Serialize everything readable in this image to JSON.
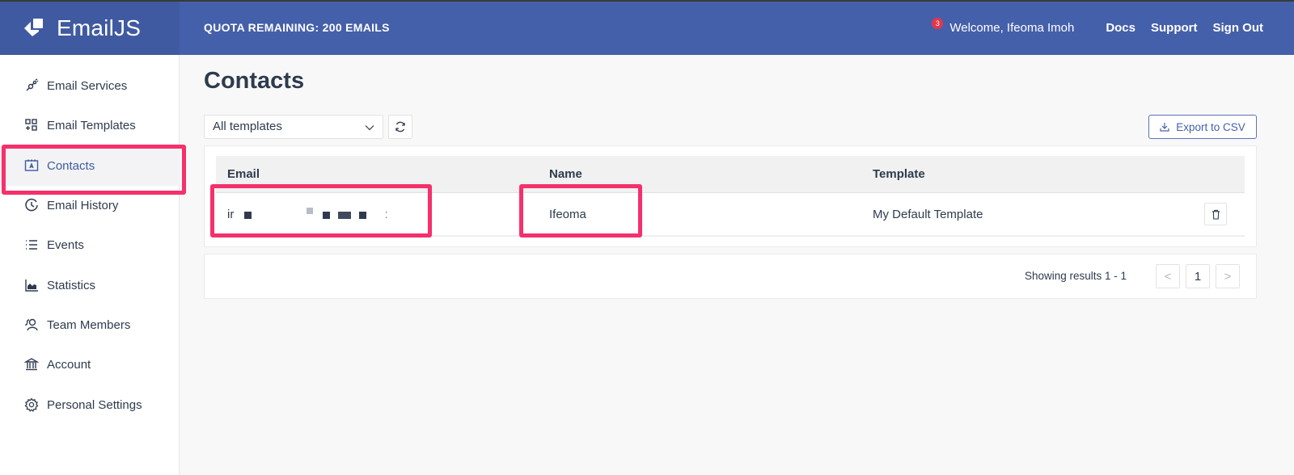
{
  "header": {
    "brand": "EmailJS",
    "quota": "QUOTA REMAINING: 200 EMAILS",
    "notification_count": "3",
    "welcome": "Welcome,  Ifeoma Imoh",
    "links": [
      "Docs",
      "Support",
      "Sign Out"
    ]
  },
  "sidebar": {
    "items": [
      {
        "label": "Email Services",
        "icon": "plug-icon"
      },
      {
        "label": "Email Templates",
        "icon": "templates-grid-icon"
      },
      {
        "label": "Contacts",
        "icon": "contact-card-icon",
        "active": true
      },
      {
        "label": "Email History",
        "icon": "history-clock-icon"
      },
      {
        "label": "Events",
        "icon": "list-icon"
      },
      {
        "label": "Statistics",
        "icon": "area-chart-icon"
      },
      {
        "label": "Team Members",
        "icon": "team-users-icon"
      },
      {
        "label": "Account",
        "icon": "bank-icon"
      },
      {
        "label": "Personal Settings",
        "icon": "gear-icon"
      }
    ]
  },
  "page": {
    "title": "Contacts",
    "filter": {
      "selected": "All templates"
    },
    "export_label": "Export to CSV"
  },
  "table": {
    "columns": [
      "Email",
      "Name",
      "Template"
    ],
    "rows": [
      {
        "email_prefix": "ir",
        "email_redacted": true,
        "name": "Ifeoma",
        "template": "My Default Template"
      }
    ]
  },
  "pagination": {
    "summary": "Showing results 1 - 1",
    "current_page": "1",
    "prev": "<",
    "next": ">"
  },
  "colors": {
    "header": "#4560aa",
    "brand_bg": "#3f5aa0",
    "highlight": "#f5306b",
    "text": "#2e3b4e",
    "badge": "#e2364b"
  }
}
